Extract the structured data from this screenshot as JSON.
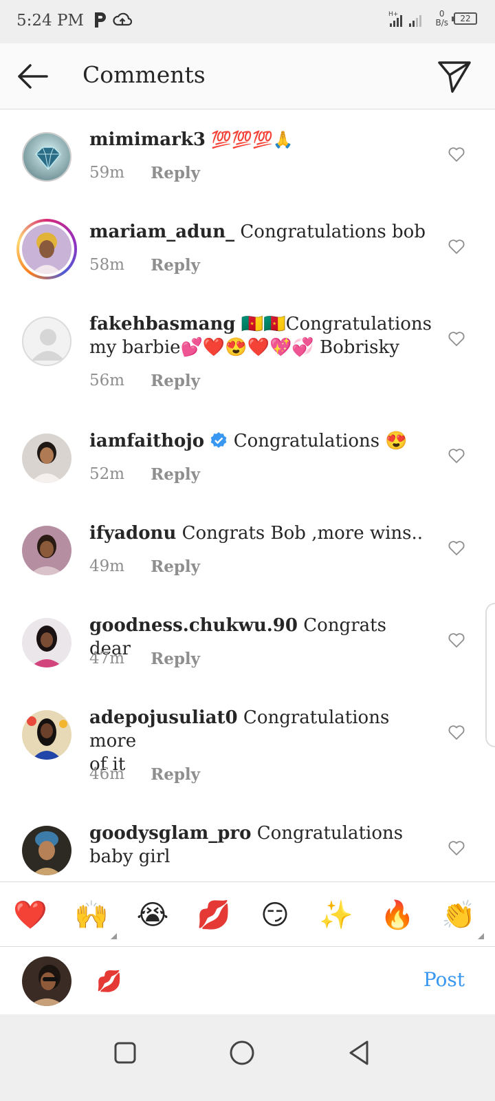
{
  "status_bar": {
    "time": "5:24 PM",
    "net_speed_value": "0",
    "net_speed_unit": "B/s",
    "battery": "22",
    "icons": [
      "p-app-icon",
      "cloud-upload-icon",
      "signal-icon",
      "battery-icon"
    ]
  },
  "header": {
    "title": "Comments",
    "icons": [
      "back-arrow-icon",
      "send-icon"
    ]
  },
  "comments": [
    {
      "username": "mimimark3",
      "text": "💯💯💯🙏",
      "time": "59m",
      "reply": "Reply"
    },
    {
      "username": "mariam_adun_",
      "text": "Congratulations bob",
      "time": "58m",
      "reply": "Reply"
    },
    {
      "username": "fakehbasmang",
      "text_line1": "🇨🇲🇨🇲Congratulations",
      "text_line2": "my barbie💕❤️😍❤️💖💞 Bobrisky",
      "time": "56m",
      "reply": "Reply"
    },
    {
      "username": "iamfaithojo",
      "text": "Congratulations 😍",
      "time": "52m",
      "reply": "Reply",
      "verified": true
    },
    {
      "username": "ifyadonu",
      "text": "Congrats Bob ,more wins..",
      "time": "49m",
      "reply": "Reply"
    },
    {
      "username": "goodness.chukwu.90",
      "text": "Congrats dear",
      "time": "47m",
      "reply": "Reply"
    },
    {
      "username": "adepojusuliat0",
      "text_line1": "Congratulations more",
      "text_line2": "of it",
      "time": "46m",
      "reply": "Reply"
    },
    {
      "username": "goodysglam_pro",
      "text_line1": "Congratulations",
      "text_line2": "baby girl"
    }
  ],
  "emoji_bar": [
    "❤️",
    "🙌",
    "😭",
    "💋",
    "😏",
    "✨",
    "🔥",
    "👏"
  ],
  "composer": {
    "value": "💋",
    "post_label": "Post"
  },
  "colors": {
    "accent": "#3897f0",
    "text": "#262626",
    "meta": "#8e8e8e",
    "verified": "#3897f0"
  }
}
